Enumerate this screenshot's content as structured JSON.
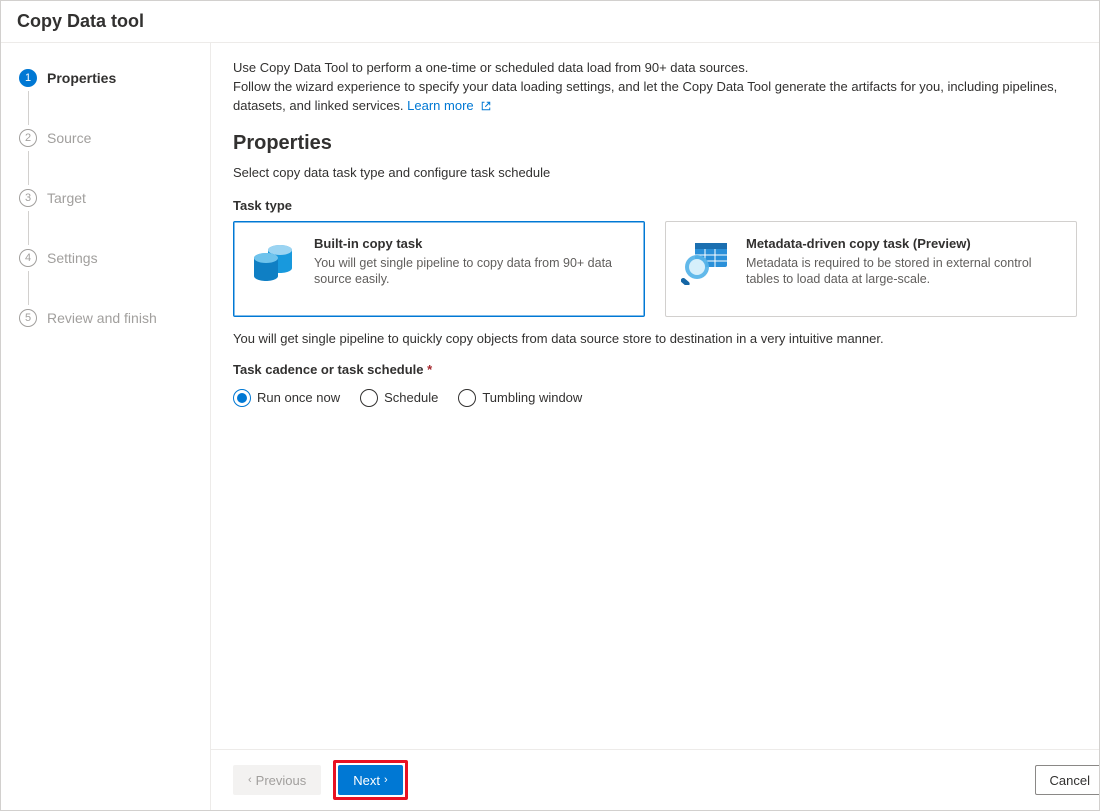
{
  "window": {
    "title": "Copy Data tool"
  },
  "sidebar": {
    "steps": [
      {
        "num": "1",
        "label": "Properties",
        "active": true
      },
      {
        "num": "2",
        "label": "Source",
        "active": false
      },
      {
        "num": "3",
        "label": "Target",
        "active": false
      },
      {
        "num": "4",
        "label": "Settings",
        "active": false
      },
      {
        "num": "5",
        "label": "Review and finish",
        "active": false
      }
    ]
  },
  "main": {
    "intro_line1": "Use Copy Data Tool to perform a one-time or scheduled data load from 90+ data sources.",
    "intro_line2_prefix": "Follow the wizard experience to specify your data loading settings, and let the Copy Data Tool generate the artifacts for you, including pipelines, datasets, and linked services. ",
    "learn_more": "Learn more",
    "section_title": "Properties",
    "section_sub": "Select copy data task type and configure task schedule",
    "task_type_label": "Task type",
    "cards": [
      {
        "title": "Built-in copy task",
        "desc": "You will get single pipeline to copy data from 90+ data source easily.",
        "selected": true
      },
      {
        "title": "Metadata-driven copy task (Preview)",
        "desc": "Metadata is required to be stored in external control tables to load data at large-scale.",
        "selected": false
      }
    ],
    "note": "You will get single pipeline to quickly copy objects from data source store to destination in a very intuitive manner.",
    "schedule_label": "Task cadence or task schedule",
    "schedule_options": [
      {
        "label": "Run once now",
        "selected": true
      },
      {
        "label": "Schedule",
        "selected": false
      },
      {
        "label": "Tumbling window",
        "selected": false
      }
    ]
  },
  "footer": {
    "previous": "Previous",
    "next": "Next",
    "cancel": "Cancel"
  }
}
